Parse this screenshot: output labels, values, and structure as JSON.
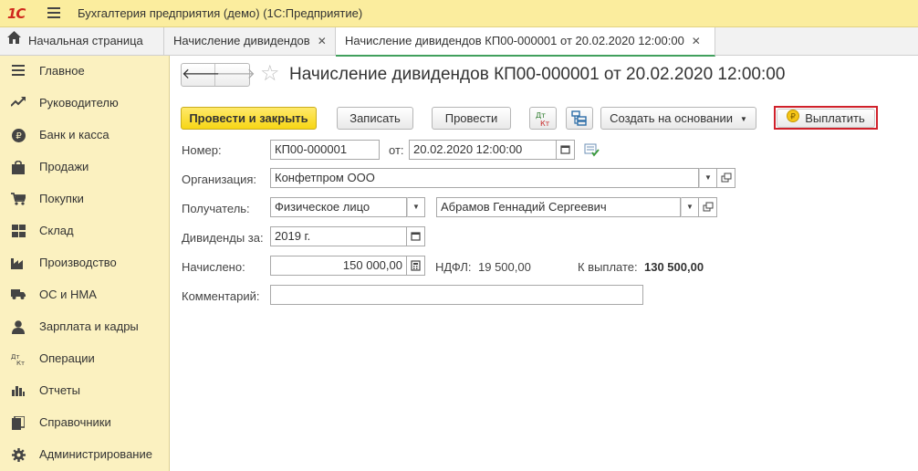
{
  "app": {
    "logo_text": "1С",
    "title": "Бухгалтерия предприятия (демо)  (1С:Предприятие)"
  },
  "tabs": [
    {
      "label": "Начальная страница",
      "icon": "home-icon"
    },
    {
      "label": "Начисление дивидендов",
      "closable": true
    },
    {
      "label": "Начисление дивидендов КП00-000001 от 20.02.2020 12:00:00",
      "closable": true,
      "active": true
    }
  ],
  "sidebar": {
    "items": [
      {
        "label": "Главное",
        "icon": "list-icon"
      },
      {
        "label": "Руководителю",
        "icon": "trend-icon"
      },
      {
        "label": "Банк и касса",
        "icon": "ruble-icon"
      },
      {
        "label": "Продажи",
        "icon": "shopping-bag-icon"
      },
      {
        "label": "Покупки",
        "icon": "cart-icon"
      },
      {
        "label": "Склад",
        "icon": "warehouse-icon"
      },
      {
        "label": "Производство",
        "icon": "factory-icon"
      },
      {
        "label": "ОС и НМА",
        "icon": "truck-icon"
      },
      {
        "label": "Зарплата и кадры",
        "icon": "person-icon"
      },
      {
        "label": "Операции",
        "icon": "dt-kt-icon"
      },
      {
        "label": "Отчеты",
        "icon": "bar-chart-icon"
      },
      {
        "label": "Справочники",
        "icon": "books-icon"
      },
      {
        "label": "Администрирование",
        "icon": "gear-icon"
      }
    ]
  },
  "document": {
    "title": "Начисление дивидендов КП00-000001 от 20.02.2020 12:00:00"
  },
  "toolbar": {
    "post_and_close": "Провести и закрыть",
    "save": "Записать",
    "post": "Провести",
    "create_based_on": "Создать на основании",
    "pay": "Выплатить"
  },
  "form": {
    "number_label": "Номер:",
    "number_value": "КП00-000001",
    "date_label": "от:",
    "date_value": "20.02.2020 12:00:00",
    "organization_label": "Организация:",
    "organization_value": "Конфетпром ООО",
    "recipient_label": "Получатель:",
    "recipient_type_value": "Физическое лицо",
    "recipient_value": "Абрамов Геннадий Сергеевич",
    "dividends_for_label": "Дивиденды за:",
    "dividends_for_value": "2019 г.",
    "accrued_label": "Начислено:",
    "accrued_value": "150 000,00",
    "ndfl_label": "НДФЛ:",
    "ndfl_value": "19 500,00",
    "to_pay_label": "К выплате:",
    "to_pay_value": "130 500,00",
    "comment_label": "Комментарий:",
    "comment_value": ""
  },
  "colors": {
    "titlebar_bg": "#fbed9e",
    "sidebar_bg": "#fbf1c0",
    "primary_button": "#f7d615",
    "highlight_frame": "#d0212b",
    "active_tab_underline": "#41a05d"
  }
}
